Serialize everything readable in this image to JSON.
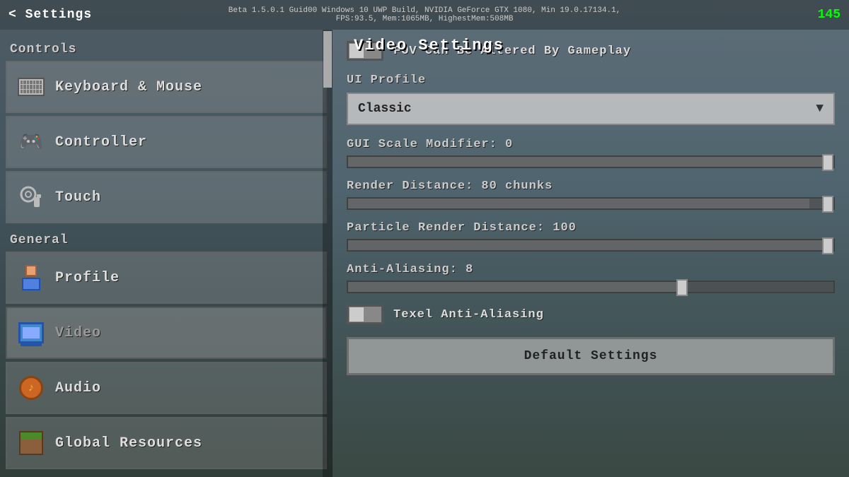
{
  "topbar": {
    "back_label": "< Settings",
    "system_info": "Beta 1.5.0.1 Guid00   Windows 10 UWP Build, NVIDIA GeForce GTX 1080, Min 19.0.17134.1, FPS:93.5, Mem:1065MB, HighestMem:508MB",
    "page_title": "Video Settings",
    "fps": "145"
  },
  "sidebar": {
    "controls_header": "Controls",
    "general_header": "General",
    "items": [
      {
        "id": "keyboard-mouse",
        "label": "Keyboard & Mouse",
        "icon": "keyboard"
      },
      {
        "id": "controller",
        "label": "Controller",
        "icon": "controller"
      },
      {
        "id": "touch",
        "label": "Touch",
        "icon": "touch"
      },
      {
        "id": "profile",
        "label": "Profile",
        "icon": "profile"
      },
      {
        "id": "video",
        "label": "Video",
        "icon": "monitor",
        "active": true
      },
      {
        "id": "audio",
        "label": "Audio",
        "icon": "audio"
      },
      {
        "id": "global-resources",
        "label": "Global Resources",
        "icon": "grass"
      }
    ]
  },
  "content": {
    "fov_toggle_label": "FOV Can Be Altered By Gameplay",
    "ui_profile_label": "UI Profile",
    "ui_profile_value": "Classic",
    "gui_scale_label": "GUI Scale Modifier: 0",
    "gui_scale_value": 100,
    "render_distance_label": "Render Distance: 80 chunks",
    "render_distance_value": 95,
    "particle_render_label": "Particle Render Distance: 100",
    "particle_render_value": 100,
    "anti_aliasing_label": "Anti-Aliasing: 8",
    "anti_aliasing_value": 70,
    "texel_label": "Texel Anti-Aliasing",
    "default_button_label": "Default Settings"
  }
}
